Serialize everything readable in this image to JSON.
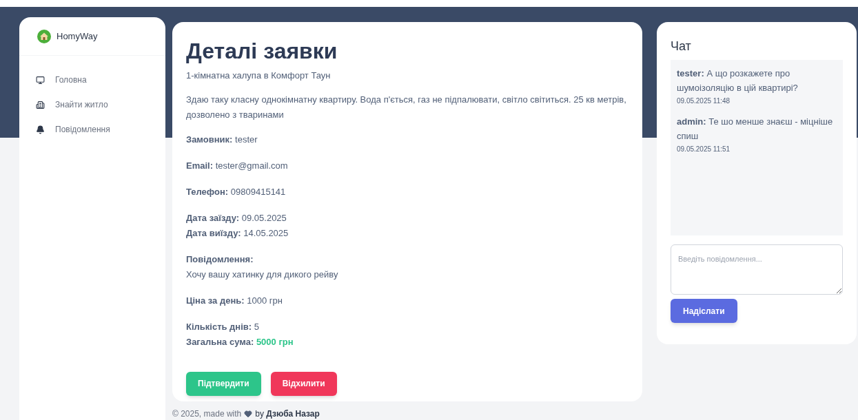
{
  "brand": {
    "name": "HomyWay"
  },
  "sidebar": {
    "items": [
      {
        "label": "Головна"
      },
      {
        "label": "Знайти житло"
      },
      {
        "label": "Повідомлення"
      }
    ]
  },
  "details": {
    "title": "Деталі заявки",
    "subtitle": "1-кімнатна халупа в Комфорт Таун",
    "description": "Здаю таку класну однокімнатну квартиру. Вода п'ється, газ не підпалювати, світло світиться. 25 кв метрів, дозволено з тваринами",
    "groups": [
      [
        {
          "kind": "inline",
          "label": "Замовник:",
          "value": "tester"
        }
      ],
      [
        {
          "kind": "inline",
          "label": "Email:",
          "value": "tester@gmail.com"
        }
      ],
      [
        {
          "kind": "inline",
          "label": "Телефон:",
          "value": "09809415141"
        }
      ],
      [
        {
          "kind": "inline",
          "label": "Дата заїзду:",
          "value": "09.05.2025"
        },
        {
          "kind": "inline",
          "label": "Дата виїзду:",
          "value": "14.05.2025"
        }
      ],
      [
        {
          "kind": "stacked",
          "label": "Повідомлення:",
          "value": "Хочу вашу хатинку для дикого рейву"
        }
      ],
      [
        {
          "kind": "inline",
          "label": "Ціна за день:",
          "value": "1000 грн"
        }
      ],
      [
        {
          "kind": "inline",
          "label": "Кількість днів:",
          "value": "5"
        },
        {
          "kind": "total",
          "label": "Загальна сума:",
          "value": "5000 грн"
        }
      ]
    ],
    "buttons": [
      {
        "label": "Підтвердити",
        "kind": "confirm"
      },
      {
        "label": "Відхилити",
        "kind": "reject"
      }
    ]
  },
  "chat": {
    "title": "Чат",
    "messages": [
      {
        "author": "tester:",
        "text": "А що розкажете про шумоізоляцію в цій квартирі?",
        "time": "09.05.2025 11:48"
      },
      {
        "author": "admin:",
        "text": "Те шо менше знаєш - міцніше спиш",
        "time": "09.05.2025 11:51"
      }
    ],
    "input": {
      "placeholder": "Введіть повідомлення..."
    },
    "send": "Надіслати"
  },
  "footer": {
    "lead": "© 2025, made with",
    "tail": "by **Дзюба Назар**"
  }
}
